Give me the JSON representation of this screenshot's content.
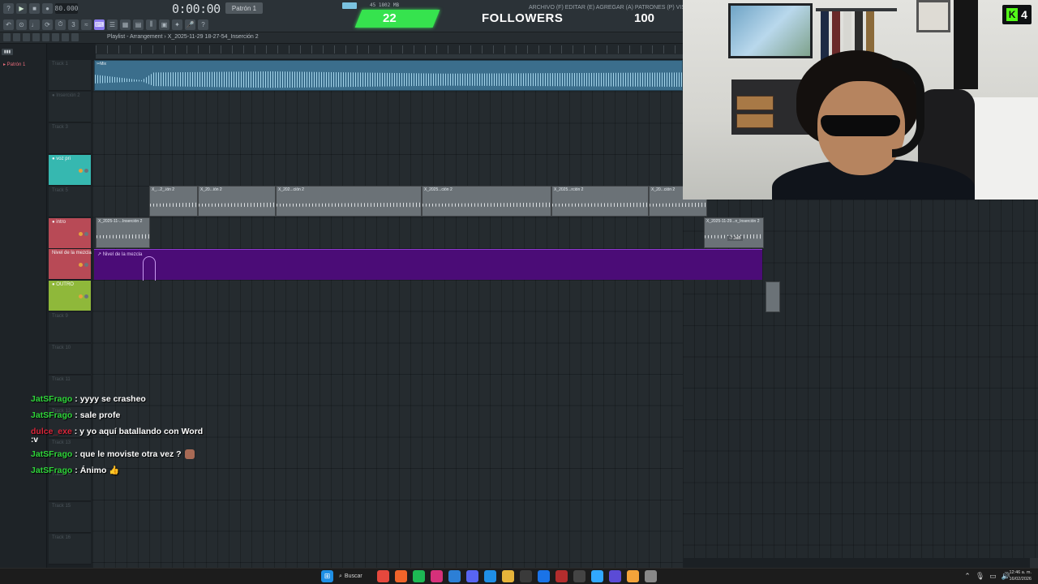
{
  "toolbar": {
    "bpm_display": "80.000",
    "clock": "0:00:00",
    "pattern": "Patrón 1",
    "cpu": "45  1802 MB",
    "menu": "ARCHIVO (F)  EDITAR (E)  AGREGAR (A)  PATRONES (P)  VISTA (V)  OPCIONES (O)"
  },
  "goal": {
    "current": "22",
    "label": "FOLLOWERS",
    "target": "100",
    "progress_fraction": 0.22,
    "color": "#36e34e"
  },
  "playlist": {
    "title": "Playlist - Arrangement › X_2025-11-29 18-27-54_Inserción 2"
  },
  "browser": {
    "tab": "▮▮▮",
    "item": "▸ Patrón 1"
  },
  "tracks": [
    {
      "name": "Track 1"
    },
    {
      "name": "● Inserción 2"
    },
    {
      "name": "Track 3"
    },
    {
      "name": "● voz pri",
      "color": "#36b8b0"
    },
    {
      "name": "Track 5"
    },
    {
      "name": "● intro",
      "color": "#b84a56"
    },
    {
      "name": "Nivel de la mezcla",
      "color": "#b84a56"
    },
    {
      "name": "● OUTRO",
      "color": "#8fb83a"
    },
    {
      "name": "Track 9"
    },
    {
      "name": "Track 10"
    },
    {
      "name": "Track 11"
    },
    {
      "name": "Track 12"
    },
    {
      "name": "Track 13"
    },
    {
      "name": "Track 14"
    },
    {
      "name": "Track 15"
    },
    {
      "name": "Track 16"
    }
  ],
  "clips": {
    "master_label": "✂Mix",
    "vocal_labels": [
      "X_...2_.ión 2",
      "X_20...ión 2",
      "X_202...ción 2",
      "X_2025...ción 2",
      "X_2025...rción 2",
      "X_20...ción 2"
    ],
    "intro_label": "X_2025-11-...Inserción 2",
    "intro_label_right": "X_2025-11-29...n_Inserción 2",
    "automation_label": "↗ Nivel de la mezcla",
    "intro_gain_label": "-7.3dB"
  },
  "chat": [
    {
      "user": "JatSFrago",
      "user_color": "#2fd63a",
      "message": "yyyy se crasheo",
      "emote": false
    },
    {
      "user": "JatSFrago",
      "user_color": "#2fd63a",
      "message": "sale profe",
      "emote": false
    },
    {
      "user": "dulce_exe",
      "user_color": "#d9253a",
      "message": "y yo aquí batallando con Word",
      "continuation": ":v",
      "emote": false
    },
    {
      "user": "JatSFrago",
      "user_color": "#2fd63a",
      "message": "que le moviste otra vez ?",
      "emote": true
    },
    {
      "user": "JatSFrago",
      "user_color": "#2fd63a",
      "message": "Ánimo 👍",
      "emote": false
    }
  ],
  "kick": {
    "count": "4",
    "logo": "K",
    "color": "#53fc18"
  },
  "taskbar": {
    "search_label": "Buscar",
    "time": "12:46 a. m.",
    "date": "16/02/2026",
    "apps": [
      "chrome-icon",
      "brave-icon",
      "spotify-icon",
      "instagram-icon",
      "vscode-icon",
      "discord-icon",
      "edge-icon",
      "files-icon",
      "store-icon",
      "outlook-icon",
      "app-icon",
      "lock-icon",
      "photoshop-icon",
      "obs-icon",
      "fl-icon",
      "settings-icon"
    ]
  }
}
